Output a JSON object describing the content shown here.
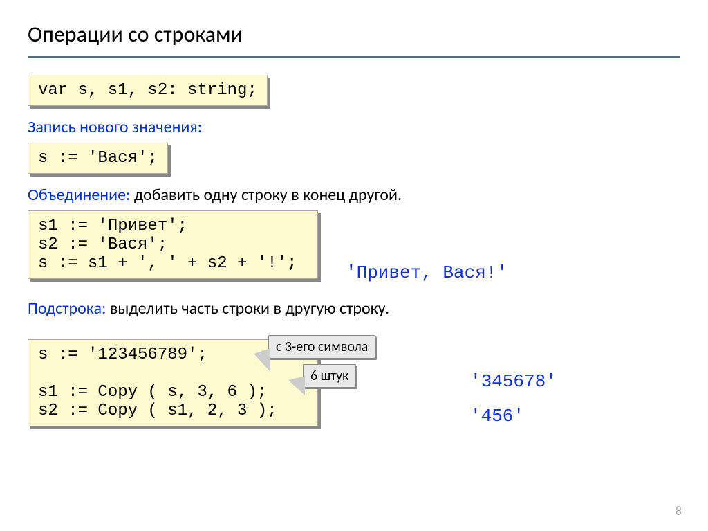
{
  "title": "Операции со строками",
  "code_declare": "var s, s1, s2: string;",
  "section_assign": {
    "term": "Запись нового значения:",
    "code": "s := 'Вася';"
  },
  "section_concat": {
    "term": "Объединение:",
    "desc": " добавить одну строку в конец другой.",
    "code": "s1 := 'Привет';\ns2 := 'Вася';\ns := s1 + ', ' + s2 + '!';",
    "result": "'Привет, Вася!'"
  },
  "section_sub": {
    "term": "Подстрока:",
    "desc": " выделить часть строки в другую строку.",
    "code": "s := '123456789';\n\ns1 := Copy ( s, 3, 6 );\ns2 := Copy ( s1, 2, 3 );",
    "callout1": "с 3-его символа",
    "callout2": "6 штук",
    "result1": "'345678'",
    "result2": "'456'"
  },
  "page_number": "8"
}
